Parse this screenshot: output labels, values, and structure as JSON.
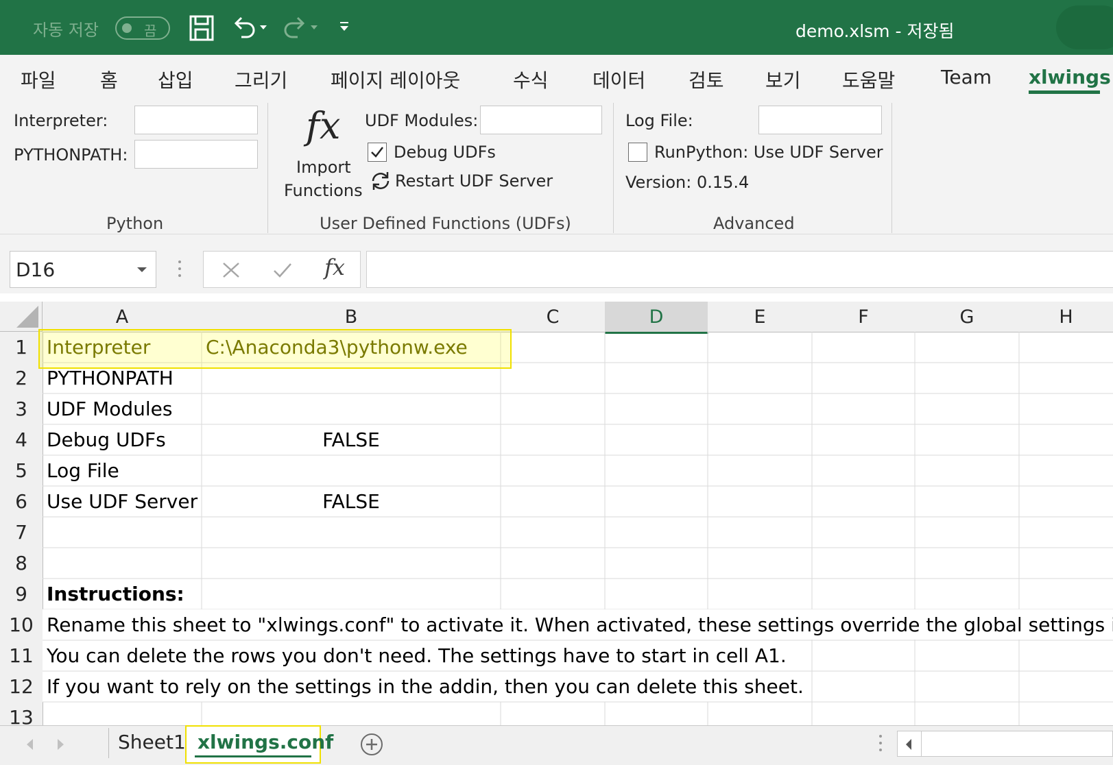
{
  "titlebar": {
    "autosave_label": "자동 저장",
    "autosave_state": "끔",
    "doc_title": "demo.xlsm  -  저장됨"
  },
  "ribbon_tabs": [
    "파일",
    "홈",
    "삽입",
    "그리기",
    "페이지 레이아웃",
    "수식",
    "데이터",
    "검토",
    "보기",
    "도움말",
    "Team",
    "xlwings"
  ],
  "ribbon": {
    "python": {
      "interpreter_label": "Interpreter:",
      "pythonpath_label": "PYTHONPATH:",
      "group_name": "Python"
    },
    "udfs": {
      "import_line1": "Import",
      "import_line2": "Functions",
      "udf_modules_label": "UDF Modules:",
      "debug_udfs_label": "Debug UDFs",
      "restart_label": "Restart UDF Server",
      "group_name": "User Defined Functions (UDFs)"
    },
    "advanced": {
      "log_file_label": "Log File:",
      "runpython_label": "RunPython: Use UDF Server",
      "version_label": "Version: 0.15.4",
      "group_name": "Advanced"
    }
  },
  "formula_bar": {
    "name_box": "D16"
  },
  "columns": [
    "A",
    "B",
    "C",
    "D",
    "E",
    "F",
    "G",
    "H"
  ],
  "rows": [
    "1",
    "2",
    "3",
    "4",
    "5",
    "6",
    "7",
    "8",
    "9",
    "10",
    "11",
    "12",
    "13"
  ],
  "cells": {
    "A1": "Interpreter",
    "B1": "C:\\Anaconda3\\pythonw.exe",
    "A2": "PYTHONPATH",
    "A3": "UDF Modules",
    "A4": "Debug UDFs",
    "B4": "FALSE",
    "A5": "Log File",
    "A6": "Use UDF Server",
    "B6": "FALSE",
    "A9": "Instructions:",
    "A10": "Rename this sheet to \"xlwings.conf\" to activate it. When activated, these settings override the global settings in",
    "A11": "You can delete the rows you don't need. The settings have to start in cell A1.",
    "A12": "If you want to rely on the settings in the addin, then you can delete this sheet."
  },
  "sheet_tabs": [
    "Sheet1",
    "xlwings.conf"
  ],
  "colors": {
    "accent": "#217346",
    "highlight": "#f0e000"
  }
}
